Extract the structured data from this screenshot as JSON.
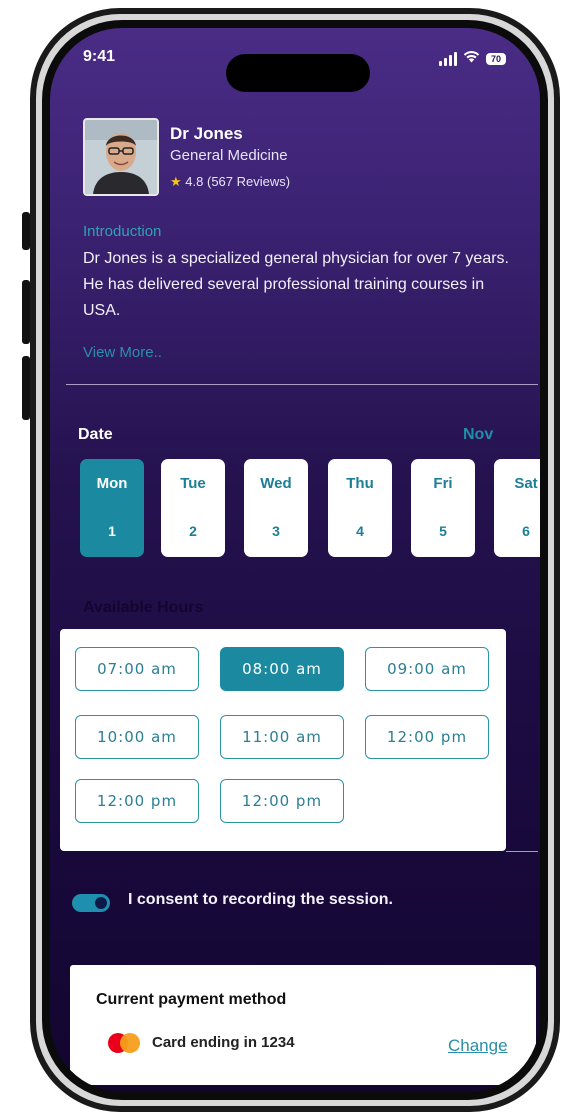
{
  "status_bar": {
    "time": "9:41",
    "battery": "70"
  },
  "doctor": {
    "name": "Dr Jones",
    "specialty": "General Medicine",
    "rating": "4.8",
    "reviews": "(567 Reviews)"
  },
  "intro": {
    "title": "Introduction",
    "text": "Dr Jones is a specialized general physician for over 7 years. He has delivered several professional training courses in USA.",
    "view_more": "View More.."
  },
  "date_picker": {
    "label": "Date",
    "month": "Nov",
    "days": [
      {
        "name": "Mon",
        "date": "1"
      },
      {
        "name": "Tue",
        "date": "2"
      },
      {
        "name": "Wed",
        "date": "3"
      },
      {
        "name": "Thu",
        "date": "4"
      },
      {
        "name": "Fri",
        "date": "5"
      },
      {
        "name": "Sat",
        "date": "6"
      }
    ],
    "selected": "Mon 1"
  },
  "hours": {
    "label": "Available Hours",
    "slots": [
      "07:00 am",
      "08:00 am",
      "09:00 am",
      "10:00 am",
      "11:00 am",
      "12:00 pm",
      "12:00 pm",
      "12:00 pm"
    ],
    "selected": "08:00 am"
  },
  "consent": {
    "label": "I consent to recording the session.",
    "enabled": true
  },
  "payment": {
    "title": "Current payment method",
    "card": "Card ending in 1234",
    "change": "Change",
    "brand_icon": "mastercard-icon"
  },
  "colors": {
    "accent": "#1b8aa0",
    "background_top": "#4a2c86",
    "background_bottom": "#12062f"
  }
}
